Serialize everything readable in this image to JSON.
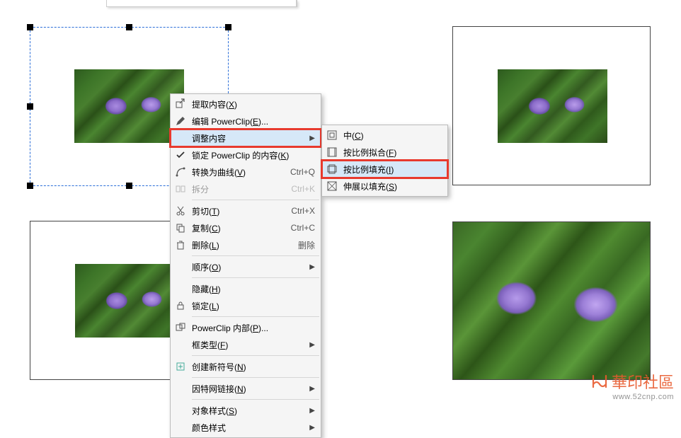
{
  "menu": {
    "extract": "提取内容(X)",
    "edit_powerclip": "编辑 PowerClip(E)...",
    "adjust_content": "调整内容",
    "lock_powerclip": "锁定 PowerClip 的内容(K)",
    "convert_curve": "转换为曲线(V)",
    "convert_curve_sc": "Ctrl+Q",
    "split": "拆分",
    "split_sc": "Ctrl+K",
    "cut": "剪切(T)",
    "cut_sc": "Ctrl+X",
    "copy": "复制(C)",
    "copy_sc": "Ctrl+C",
    "delete": "删除(L)",
    "delete_sc": "删除",
    "order": "顺序(O)",
    "hide": "隐藏(H)",
    "lock": "锁定(L)",
    "powerclip_inside": "PowerClip 内部(P)...",
    "frame_type": "框类型(F)",
    "create_symbol": "创建新符号(N)",
    "internet_link": "因特网链接(N)",
    "object_style": "对象样式(S)",
    "color_style": "颜色样式"
  },
  "submenu": {
    "center": "中(C)",
    "fit_prop": "按比例拟合(F)",
    "fill_prop": "按比例填充(I)",
    "stretch": "伸展以填充(S)"
  },
  "watermark": {
    "brand": "華印社區",
    "url": "www.52cnp.com"
  }
}
